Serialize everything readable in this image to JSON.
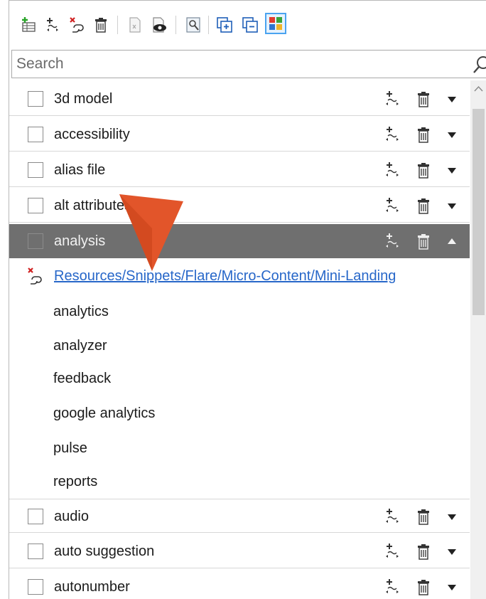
{
  "search": {
    "placeholder": "Search",
    "value": ""
  },
  "toolbar": {
    "icons": [
      "add-condition-set-icon",
      "add-tag-icon",
      "remove-link-icon",
      "delete-icon",
      "document-icon",
      "preview-icon",
      "inspect-icon",
      "expand-all-icon",
      "collapse-all-icon",
      "grid-view-icon"
    ]
  },
  "terms": {
    "row1": "3d model",
    "row2": "accessibility",
    "row3": "alias file",
    "row4": "alt attributes",
    "row5": "analysis",
    "row6": "audio",
    "row7": "auto suggestion",
    "row8": "autonumber"
  },
  "expanded": {
    "link": "Resources/Snippets/Flare/Micro-Content/Mini-Landing",
    "synonyms": [
      "analytics",
      "analyzer",
      "feedback",
      "google analytics",
      "pulse",
      "reports"
    ]
  },
  "colors": {
    "selected_row": "#6f6f6f",
    "link": "#2767c9",
    "pointer": "#e2552a",
    "toolbar_selected": "#4aa3f0"
  }
}
